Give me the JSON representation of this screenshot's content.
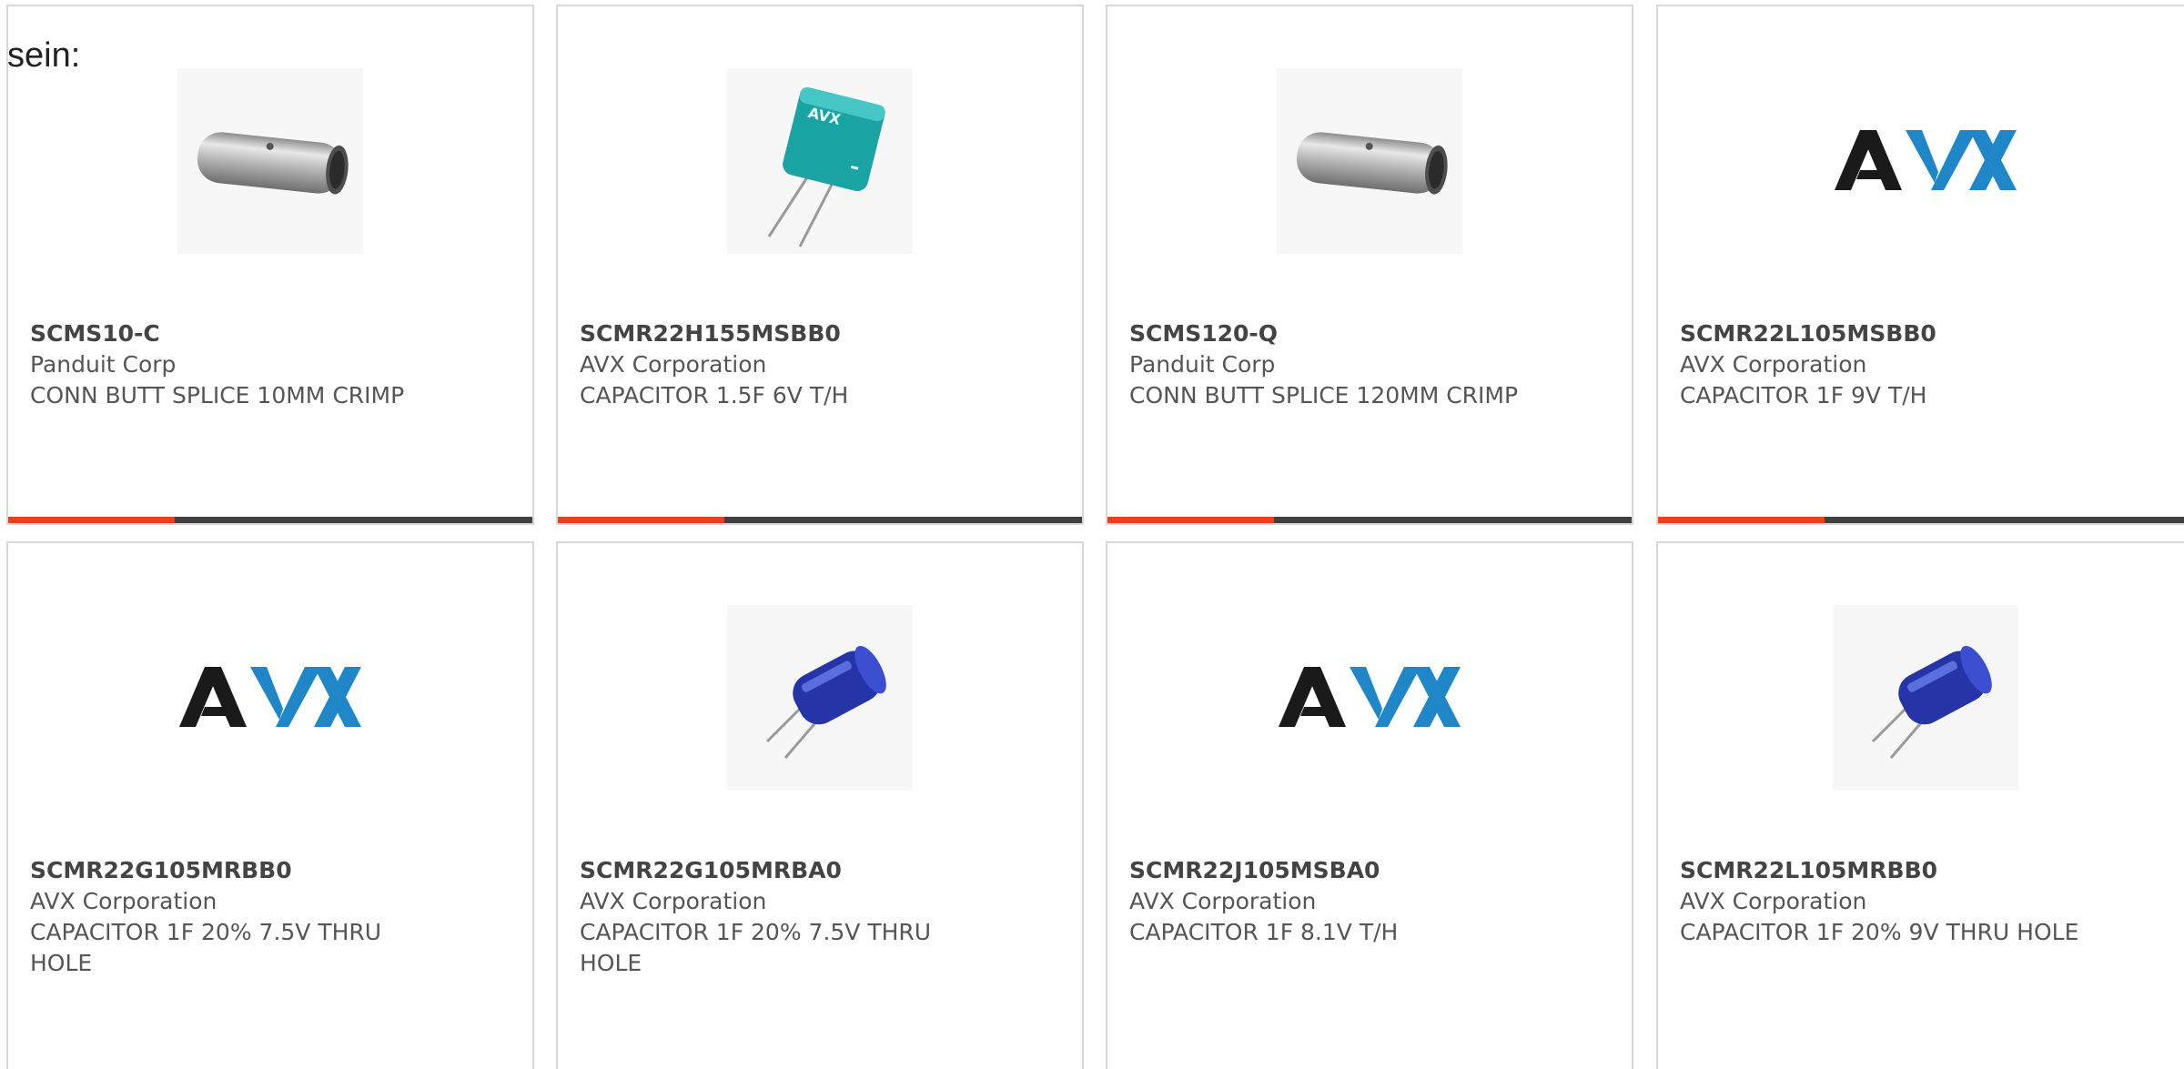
{
  "intro_text": "sein:",
  "products": [
    {
      "part_number": "SCMS10-C",
      "manufacturer": "Panduit Corp",
      "description": "CONN BUTT SPLICE 10MM CRIMP",
      "image": "butt-splice"
    },
    {
      "part_number": "SCMR22H155MSBB0",
      "manufacturer": "AVX Corporation",
      "description": "CAPACITOR 1.5F 6V T/H",
      "image": "teal-capacitor"
    },
    {
      "part_number": "SCMS120-Q",
      "manufacturer": "Panduit Corp",
      "description": "CONN BUTT SPLICE 120MM CRIMP",
      "image": "butt-splice"
    },
    {
      "part_number": "SCMR22L105MSBB0",
      "manufacturer": "AVX Corporation",
      "description": "CAPACITOR 1F 9V T/H",
      "image": "avx-logo"
    },
    {
      "part_number": "SCMR22G105MRBB0",
      "manufacturer": "AVX Corporation",
      "description": "CAPACITOR 1F 20% 7.5V THRU HOLE",
      "image": "avx-logo"
    },
    {
      "part_number": "SCMR22G105MRBA0",
      "manufacturer": "AVX Corporation",
      "description": "CAPACITOR 1F 20% 7.5V THRU HOLE",
      "image": "blue-capacitor"
    },
    {
      "part_number": "SCMR22J105MSBA0",
      "manufacturer": "AVX Corporation",
      "description": "CAPACITOR 1F 8.1V T/H",
      "image": "avx-logo"
    },
    {
      "part_number": "SCMR22L105MRBB0",
      "manufacturer": "AVX Corporation",
      "description": "CAPACITOR 1F 20% 9V THRU HOLE",
      "image": "blue-capacitor"
    }
  ],
  "colors": {
    "accent": "#e8411b",
    "bar_dark": "#3f3f3f",
    "card_border": "#d8d8d8",
    "avx_black": "#1a1a1a",
    "avx_blue": "#1f86c8"
  }
}
